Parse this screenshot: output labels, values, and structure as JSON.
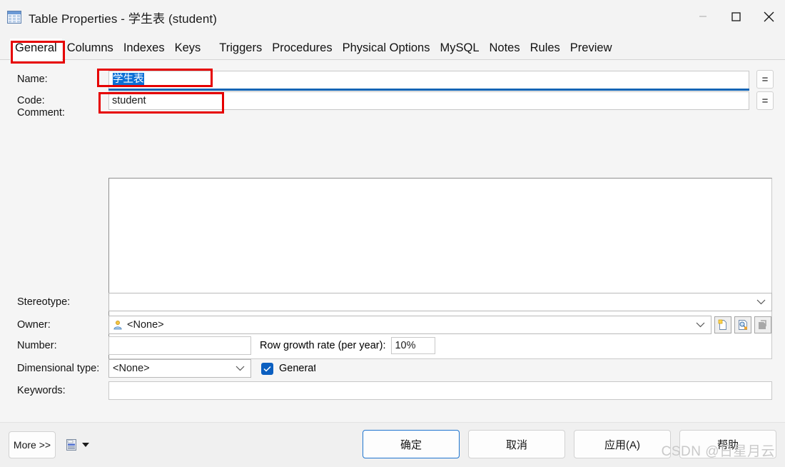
{
  "window": {
    "title": "Table Properties - 学生表 (student)",
    "icon": "table-icon",
    "controls": {
      "minimize": "minimize-icon",
      "maximize": "maximize-icon",
      "close": "close-icon"
    }
  },
  "tabs": [
    {
      "label": "General",
      "selected": true
    },
    {
      "label": "Columns",
      "selected": false
    },
    {
      "label": "Indexes",
      "selected": false
    },
    {
      "label": "Keys",
      "selected": false
    },
    {
      "label": "Triggers",
      "selected": false
    },
    {
      "label": "Procedures",
      "selected": false
    },
    {
      "label": "Physical Options",
      "selected": false
    },
    {
      "label": "MySQL",
      "selected": false
    },
    {
      "label": "Notes",
      "selected": false
    },
    {
      "label": "Rules",
      "selected": false
    },
    {
      "label": "Preview",
      "selected": false
    }
  ],
  "form": {
    "name": {
      "label": "Name:",
      "value": "学生表",
      "selected": true
    },
    "code": {
      "label": "Code:",
      "value": "student"
    },
    "equals_button": "=",
    "comment": {
      "label": "Comment:",
      "value": ""
    },
    "stereotype": {
      "label": "Stereotype:",
      "value": ""
    },
    "owner": {
      "label": "Owner:",
      "value": "<None>",
      "icon": "user-icon",
      "buttons": [
        "create-icon",
        "properties-icon",
        "delete-icon"
      ]
    },
    "number": {
      "label": "Number:",
      "value": ""
    },
    "row_growth": {
      "label": "Row growth rate (per year):",
      "value": "10%"
    },
    "dimensional_type": {
      "label": "Dimensional type:",
      "value": "<None>"
    },
    "generate": {
      "label": "Generate",
      "checked": true
    },
    "keywords": {
      "label": "Keywords:",
      "value": ""
    }
  },
  "footer": {
    "more": "More >>",
    "report_icon": "report-icon",
    "report_dropdown": "chevron-down-icon",
    "ok": "确定",
    "cancel": "取消",
    "apply": "应用(A)",
    "help": "帮助"
  },
  "watermark": "CSDN @日星月云",
  "colors": {
    "accent": "#0b6fd6",
    "focus_border": "#1f75cf",
    "annotation": "#e60000",
    "window_bg": "#f3f3f3",
    "content_bg": "#f5f5f5"
  }
}
